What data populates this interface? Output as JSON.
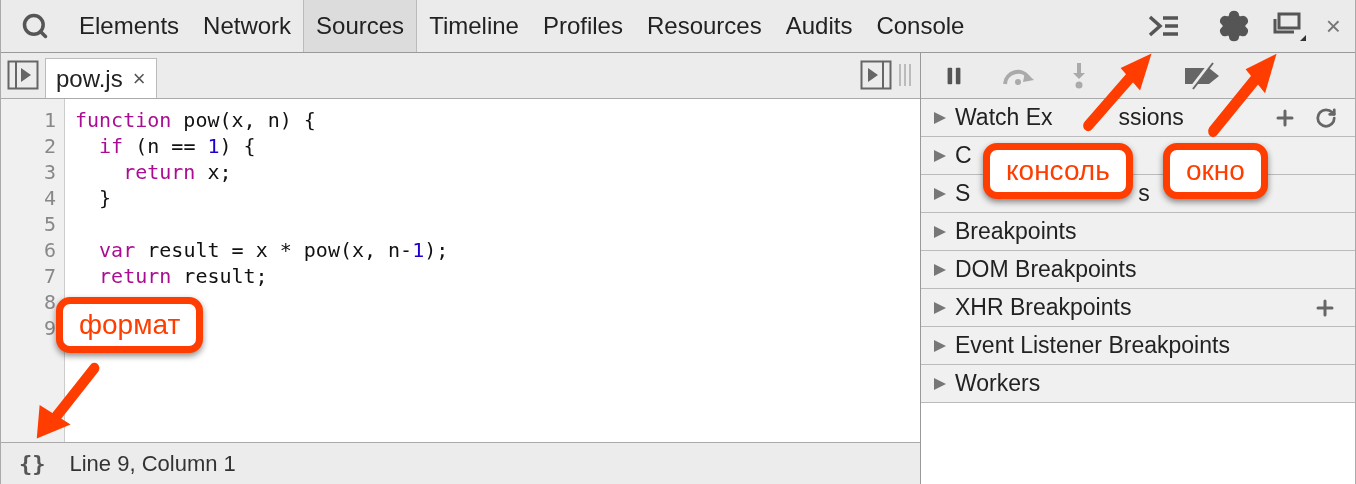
{
  "toolbar": {
    "tabs": [
      {
        "label": "Elements",
        "selected": false
      },
      {
        "label": "Network",
        "selected": false
      },
      {
        "label": "Sources",
        "selected": true
      },
      {
        "label": "Timeline",
        "selected": false
      },
      {
        "label": "Profiles",
        "selected": false
      },
      {
        "label": "Resources",
        "selected": false
      },
      {
        "label": "Audits",
        "selected": false
      },
      {
        "label": "Console",
        "selected": false
      }
    ],
    "close": "×"
  },
  "editor": {
    "file_tab": {
      "label": "pow.js",
      "close": "×"
    },
    "lines": [
      {
        "number": "1",
        "tokens": [
          {
            "kind": "keyword",
            "text": "function"
          },
          {
            "kind": "plain",
            "text": " pow(x, n) {"
          }
        ]
      },
      {
        "number": "2",
        "tokens": [
          {
            "kind": "keyword",
            "text": "  if"
          },
          {
            "kind": "plain",
            "text": " (n == "
          },
          {
            "kind": "number",
            "text": "1"
          },
          {
            "kind": "plain",
            "text": ") {"
          }
        ]
      },
      {
        "number": "3",
        "tokens": [
          {
            "kind": "keyword",
            "text": "    return"
          },
          {
            "kind": "plain",
            "text": " x;"
          }
        ]
      },
      {
        "number": "4",
        "tokens": [
          {
            "kind": "plain",
            "text": "  }"
          }
        ]
      },
      {
        "number": "5"
      },
      {
        "number": "6",
        "tokens": [
          {
            "kind": "keyword",
            "text": "  var"
          },
          {
            "kind": "plain",
            "text": " result = x * pow(x, n-"
          },
          {
            "kind": "number",
            "text": "1"
          },
          {
            "kind": "plain",
            "text": ");"
          }
        ]
      },
      {
        "number": "7",
        "tokens": [
          {
            "kind": "keyword",
            "text": "  return"
          },
          {
            "kind": "plain",
            "text": " result;"
          }
        ]
      },
      {
        "number": "8"
      },
      {
        "number": "9"
      }
    ],
    "status": {
      "format_button": "{}",
      "position": "Line 9, Column 1"
    }
  },
  "sidebar": {
    "sections": [
      {
        "label": "Watch Ex",
        "tail": "ssions",
        "add_button": true,
        "refresh_button": true
      },
      {
        "label": "C"
      },
      {
        "label": "S",
        "tail": "s"
      },
      {
        "label": "Breakpoints"
      },
      {
        "label": "DOM Breakpoints"
      },
      {
        "label": "XHR Breakpoints",
        "add_button": true
      },
      {
        "label": "Event Listener Breakpoints"
      },
      {
        "label": "Workers"
      }
    ]
  },
  "callouts": {
    "format": {
      "text": "формат"
    },
    "console": {
      "text": "консоль"
    },
    "window": {
      "text": "окно"
    }
  }
}
